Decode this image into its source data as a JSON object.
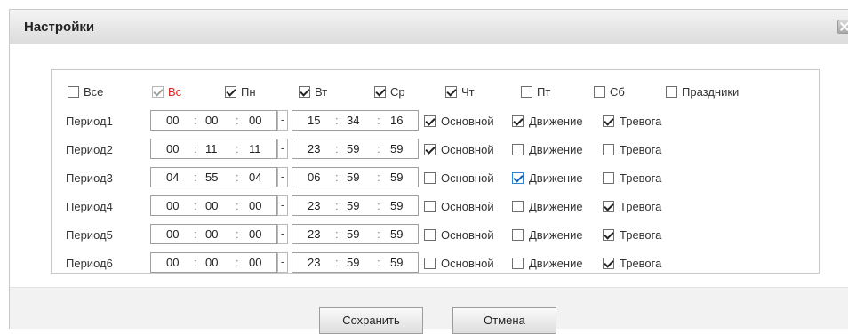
{
  "dialog": {
    "title": "Настройки",
    "close_label": "×"
  },
  "days": [
    {
      "label": "Все",
      "checked": false,
      "style": "normal"
    },
    {
      "label": "Вс",
      "checked": true,
      "style": "disabled-red"
    },
    {
      "label": "Пн",
      "checked": true,
      "style": "normal"
    },
    {
      "label": "Вт",
      "checked": true,
      "style": "normal"
    },
    {
      "label": "Ср",
      "checked": true,
      "style": "normal"
    },
    {
      "label": "Чт",
      "checked": true,
      "style": "normal"
    },
    {
      "label": "Пт",
      "checked": false,
      "style": "normal"
    },
    {
      "label": "Сб",
      "checked": false,
      "style": "normal"
    },
    {
      "label": "Праздники",
      "checked": false,
      "style": "normal"
    }
  ],
  "time_separator": ":",
  "range_separator": "-",
  "type_labels": {
    "main": "Основной",
    "motion": "Движение",
    "alarm": "Тревога"
  },
  "periods": [
    {
      "label": "Период1",
      "start": [
        "00",
        "00",
        "00"
      ],
      "end": [
        "15",
        "34",
        "16"
      ],
      "main": true,
      "motion": true,
      "alarm": true
    },
    {
      "label": "Период2",
      "start": [
        "00",
        "11",
        "11"
      ],
      "end": [
        "23",
        "59",
        "59"
      ],
      "main": true,
      "motion": false,
      "alarm": false
    },
    {
      "label": "Период3",
      "start": [
        "04",
        "55",
        "04"
      ],
      "end": [
        "06",
        "59",
        "59"
      ],
      "main": false,
      "motion": true,
      "alarm": false
    },
    {
      "label": "Период4",
      "start": [
        "00",
        "00",
        "00"
      ],
      "end": [
        "23",
        "59",
        "59"
      ],
      "main": false,
      "motion": false,
      "alarm": true
    },
    {
      "label": "Период5",
      "start": [
        "00",
        "00",
        "00"
      ],
      "end": [
        "23",
        "59",
        "59"
      ],
      "main": false,
      "motion": false,
      "alarm": true
    },
    {
      "label": "Период6",
      "start": [
        "00",
        "00",
        "00"
      ],
      "end": [
        "23",
        "59",
        "59"
      ],
      "main": false,
      "motion": false,
      "alarm": true
    }
  ],
  "buttons": {
    "save": "Сохранить",
    "cancel": "Отмена"
  },
  "colors": {
    "sunday_label": "#e02020",
    "focus_checkbox": "#2a84d6"
  }
}
